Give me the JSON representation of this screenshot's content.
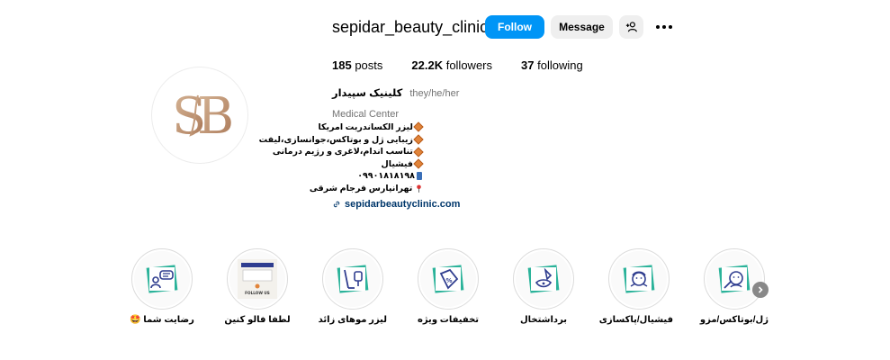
{
  "profile": {
    "username": "sepidar_beauty_clinic",
    "avatar_text": "SB",
    "buttons": {
      "follow": "Follow",
      "message": "Message"
    },
    "stats": {
      "posts": "185",
      "posts_label": " posts",
      "followers": "22.2K",
      "followers_label": " followers",
      "following": "37",
      "following_label": " following"
    },
    "display_name": "کلینیک سپیدار",
    "pronouns": "they/he/her",
    "category": "Medical Center",
    "bio_lines": [
      "لیزر الکساندریت امریکا",
      "زیبایی ژل و بوتاکس،جوانسازی،لیفت",
      "تناسب اندام،لاغری و رژیم درمانی",
      "فیشیال",
      "۰۹۹۰۱۸۱۸۱۹۸",
      "تهرانپارس فرجام شرقی"
    ],
    "link": "sepidarbeautyclinic.com"
  },
  "highlights": [
    {
      "label": "رضایت شما 🤩",
      "icon": "chat-review-icon"
    },
    {
      "label": "لطفا فالو کنین",
      "icon": "follow-us-poster"
    },
    {
      "label": "لیزر موهای زائد",
      "icon": "laser-hair-icon"
    },
    {
      "label": "تخفیفات ویژه",
      "icon": "discount-tag-icon"
    },
    {
      "label": "برداشتخال",
      "icon": "mole-removal-icon"
    },
    {
      "label": "فیشیال/پاکسازی",
      "icon": "facial-icon"
    },
    {
      "label": "ژل/بوتاکس/مزو",
      "icon": "botox-icon"
    }
  ],
  "poster_text": "FOLLOW US",
  "colors": {
    "accent": "#0095f6",
    "ring_green": "#2bb39a",
    "ring_teal": "#1f7a6b",
    "icon_navy": "#2f3d8f",
    "brand_gold": "#c59a7a"
  }
}
